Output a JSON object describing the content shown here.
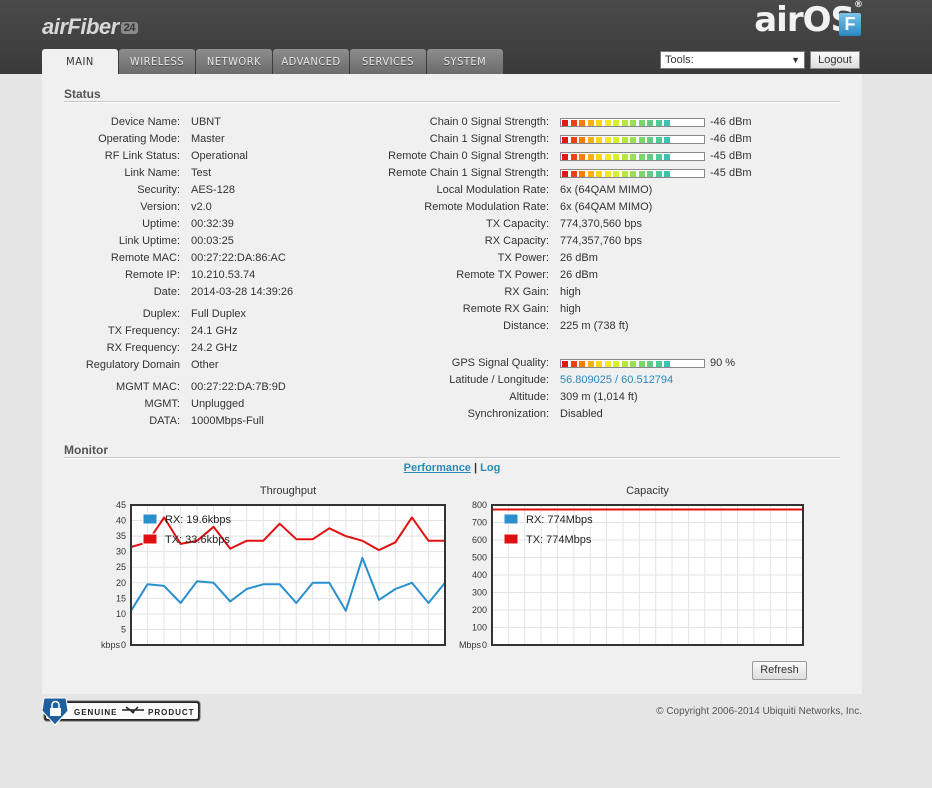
{
  "brand": {
    "logo_text": "airFiber",
    "logo_badge": "24",
    "os_name": "airOS",
    "os_reg": "®",
    "os_badge": "F"
  },
  "tabs": [
    {
      "label": "MAIN",
      "active": true
    },
    {
      "label": "WIRELESS",
      "active": false
    },
    {
      "label": "NETWORK",
      "active": false
    },
    {
      "label": "ADVANCED",
      "active": false
    },
    {
      "label": "SERVICES",
      "active": false
    },
    {
      "label": "SYSTEM",
      "active": false
    }
  ],
  "toolbar": {
    "tools_label": "Tools:",
    "logout_label": "Logout"
  },
  "status": {
    "title": "Status",
    "left": [
      {
        "label": "Device Name:",
        "value": "UBNT"
      },
      {
        "label": "Operating Mode:",
        "value": "Master"
      },
      {
        "label": "RF Link Status:",
        "value": "Operational"
      },
      {
        "label": "Link Name:",
        "value": "Test"
      },
      {
        "label": "Security:",
        "value": "AES-128"
      },
      {
        "label": "Version:",
        "value": "v2.0"
      },
      {
        "label": "Uptime:",
        "value": "00:32:39"
      },
      {
        "label": "Link Uptime:",
        "value": "00:03:25"
      },
      {
        "label": "Remote MAC:",
        "value": "00:27:22:DA:86:AC"
      },
      {
        "label": "Remote IP:",
        "value": "10.210.53.74"
      },
      {
        "label": "Date:",
        "value": "2014-03-28 14:39:26"
      },
      {
        "label": "Duplex:",
        "value": "Full Duplex"
      },
      {
        "label": "TX Frequency:",
        "value": "24.1 GHz"
      },
      {
        "label": "RX Frequency:",
        "value": "24.2 GHz"
      },
      {
        "label": "Regulatory Domain",
        "value": "Other"
      },
      {
        "label": "MGMT MAC:",
        "value": "00:27:22:DA:7B:9D"
      },
      {
        "label": "MGMT:",
        "value": "Unplugged"
      },
      {
        "label": "DATA:",
        "value": "1000Mbps-Full"
      }
    ],
    "right": [
      {
        "label": "Chain 0 Signal Strength:",
        "value": "-46 dBm",
        "level": 0.85
      },
      {
        "label": "Chain 1 Signal Strength:",
        "value": "-46 dBm",
        "level": 0.85
      },
      {
        "label": "Remote Chain 0 Signal Strength:",
        "value": "-45 dBm",
        "level": 0.88
      },
      {
        "label": "Remote Chain 1 Signal Strength:",
        "value": "-45 dBm",
        "level": 0.88
      },
      {
        "label": "Local Modulation Rate:",
        "value": "6x (64QAM MIMO)"
      },
      {
        "label": "Remote Modulation Rate:",
        "value": "6x (64QAM MIMO)"
      },
      {
        "label": "TX Capacity:",
        "value": "774,370,560 bps"
      },
      {
        "label": "RX Capacity:",
        "value": "774,357,760 bps"
      },
      {
        "label": "TX Power:",
        "value": "26 dBm"
      },
      {
        "label": "Remote TX Power:",
        "value": "26 dBm"
      },
      {
        "label": "RX Gain:",
        "value": "high"
      },
      {
        "label": "Remote RX Gain:",
        "value": "high"
      },
      {
        "label": "Distance:",
        "value": "225 m (738 ft)"
      },
      {
        "label": "GPS Signal Quality:",
        "value": "90 %",
        "level": 0.9
      },
      {
        "label": "Latitude / Longitude:",
        "value": "56.809025 / 60.512794",
        "link": true
      },
      {
        "label": "Altitude:",
        "value": "309 m (1,014 ft)"
      },
      {
        "label": "Synchronization:",
        "value": "Disabled"
      }
    ]
  },
  "monitor": {
    "title": "Monitor",
    "link_performance": "Performance",
    "separator": "|",
    "link_log": "Log",
    "refresh_label": "Refresh"
  },
  "colors": {
    "rx": "#2a8fcd",
    "tx": "#e01010"
  },
  "chart_data": [
    {
      "type": "line",
      "title": "Throughput",
      "ylabel": "kbps",
      "ylim": [
        0,
        45
      ],
      "yticks": [
        0,
        5,
        10,
        15,
        20,
        25,
        30,
        35,
        40,
        45
      ],
      "grid": true,
      "legend": "top-left",
      "series": [
        {
          "name": "RX: 19.6kbps",
          "color": "#2a8fcd",
          "values": [
            11,
            19.5,
            19,
            13.5,
            20.5,
            20,
            14,
            18,
            19.5,
            19.5,
            13.5,
            20,
            20,
            11,
            28,
            14.5,
            18,
            20,
            13.5,
            20
          ]
        },
        {
          "name": "TX: 33.6kbps",
          "color": "#e01010",
          "values": [
            31.5,
            33,
            41,
            32.5,
            33.5,
            38,
            31,
            33.5,
            33.5,
            39,
            34,
            34,
            37.5,
            35,
            33.5,
            30.5,
            33,
            41,
            33.5,
            33.5
          ]
        }
      ]
    },
    {
      "type": "line",
      "title": "Capacity",
      "ylabel": "Mbps",
      "ylim": [
        0,
        800
      ],
      "yticks": [
        0,
        100,
        200,
        300,
        400,
        500,
        600,
        700,
        800
      ],
      "grid": true,
      "legend": "top-left",
      "series": [
        {
          "name": "RX: 774Mbps",
          "color": "#2a8fcd",
          "values": [
            774,
            774,
            774,
            774,
            774,
            774,
            774,
            774,
            774,
            774,
            774,
            774,
            774,
            774,
            774,
            774,
            774,
            774,
            774,
            774
          ]
        },
        {
          "name": "TX: 774Mbps",
          "color": "#e01010",
          "values": [
            774,
            774,
            774,
            774,
            774,
            774,
            774,
            774,
            774,
            774,
            774,
            774,
            774,
            774,
            774,
            774,
            774,
            774,
            774,
            774
          ]
        }
      ]
    }
  ],
  "footer": {
    "badge_left": "GENUINE",
    "badge_right": "PRODUCT",
    "copyright": "© Copyright 2006-2014 Ubiquiti Networks, Inc."
  }
}
